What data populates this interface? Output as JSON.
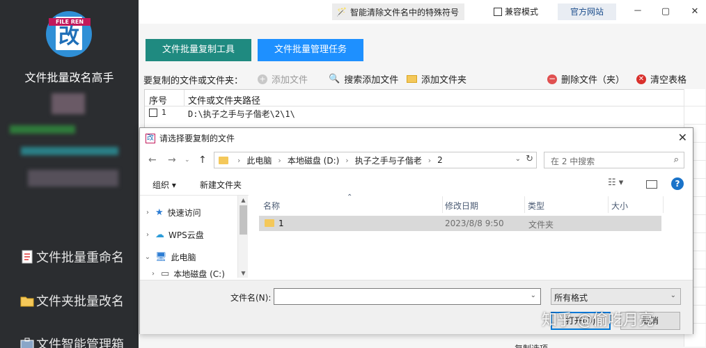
{
  "sidebar": {
    "app_title": "文件批量改名高手",
    "logo_text": "FILE REN",
    "logo_glyph": "改",
    "nav": [
      {
        "label": "文件批量重命名",
        "icon": "document-icon"
      },
      {
        "label": "文件夹批量改名",
        "icon": "folder-icon"
      },
      {
        "label": "文件智能管理箱",
        "icon": "toolbox-icon"
      }
    ]
  },
  "topbar": {
    "special_chars": "智能清除文件名中的特殊符号",
    "compat_mode": "兼容模式",
    "official_site": "官方网站",
    "minimize": "－",
    "maximize": "▢",
    "close": "✕"
  },
  "main": {
    "tabs": [
      "文件批量复制工具",
      "文件批量管理任务"
    ],
    "files_label": "要复制的文件或文件夹：",
    "tools": {
      "add_file": "添加文件",
      "search_add": "搜索添加文件",
      "add_folder": "添加文件夹",
      "delete": "删除文件（夹）",
      "clear": "清空表格"
    },
    "table": {
      "columns": [
        "序号",
        "文件或文件夹路径"
      ],
      "rows": [
        {
          "num": "1",
          "path": "D:\\执子之手与子偕老\\2\\1\\"
        }
      ]
    },
    "bottom_hint": "复制选项"
  },
  "dialog": {
    "title": "请选择要复制的文件",
    "close": "✕",
    "breadcrumb": [
      "此电脑",
      "本地磁盘 (D:)",
      "执子之手与子偕老",
      "2"
    ],
    "search_placeholder": "在 2 中搜索",
    "organize": "组织 ▾",
    "new_folder": "新建文件夹",
    "tree": [
      {
        "label": "快速访问",
        "expander": "›",
        "icon": "★"
      },
      {
        "label": "WPS云盘",
        "expander": "›",
        "icon": "☁"
      },
      {
        "label": "此电脑",
        "expander": "⌄",
        "icon": "🖥"
      },
      {
        "label": "本地磁盘 (C:)",
        "expander": "›",
        "icon": "▭"
      }
    ],
    "columns": [
      "名称",
      "修改日期",
      "类型",
      "大小"
    ],
    "files": [
      {
        "name": "1",
        "date": "2023/8/8 9:50",
        "type": "文件夹",
        "size": ""
      }
    ],
    "filename_label": "文件名(N):",
    "filename_value": "",
    "filter": "所有格式",
    "open_btn": "打开(O)",
    "cancel_btn": "取消"
  },
  "watermark": "知乎 @偷吃月亮",
  "colors": {
    "sidebar_bg": "#2b2d30",
    "tab_teal": "#1f8a80",
    "tab_blue": "#1e90ff",
    "accent": "#0078d7"
  }
}
